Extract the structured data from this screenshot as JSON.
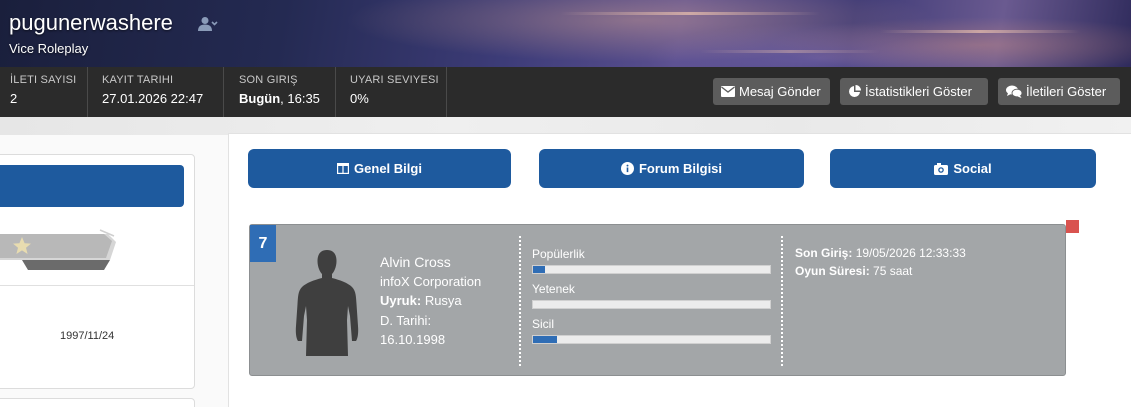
{
  "profile": {
    "username": "pugunerwashere",
    "server": "Vice Roleplay"
  },
  "stats": [
    {
      "label": "İLETI SAYISI",
      "value": "2"
    },
    {
      "label": "KAYIT TARIHI",
      "value": "27.01.2026 22:47"
    },
    {
      "label": "SON GIRIŞ",
      "value_bold": "Bugün",
      "value_rest": ", 16:35"
    },
    {
      "label": "UYARI SEVIYESI",
      "value": "0%"
    }
  ],
  "actions": {
    "message": "Mesaj Gönder",
    "statistics": "İstatistikleri Göster",
    "posts": "İletileri Göster"
  },
  "left": {
    "date": "1997/11/24"
  },
  "tabs": [
    "Genel Bilgi",
    "Forum Bilgisi",
    "Social"
  ],
  "character": {
    "number": "7",
    "name": "Alvin Cross",
    "company": "infoX Corporation",
    "nationality_label": "Uyruk:",
    "nationality": "Rusya",
    "birth_label": "D. Tarihi:",
    "birth_date": "16.10.1998",
    "bars": [
      {
        "label": "Popülerlik",
        "fraction": 0.05
      },
      {
        "label": "Yetenek",
        "fraction": 0.0
      },
      {
        "label": "Sicil",
        "fraction": 0.1
      }
    ],
    "last_login_label": "Son Giriş:",
    "last_login": "19/05/2026 12:33:33",
    "playtime_label": "Oyun Süresi:",
    "playtime": "75 saat"
  },
  "colors": {
    "primary": "#1e5a9e",
    "bar_fill": "#2f6db5",
    "card_bg": "#a3a6a8",
    "stats_bar": "#2b2b2b",
    "alert": "#d9534f"
  },
  "icons": [
    "user-icon",
    "envelope-icon",
    "pie-chart-icon",
    "comments-icon",
    "columns-icon",
    "info-icon",
    "camera-icon",
    "star-icon"
  ]
}
